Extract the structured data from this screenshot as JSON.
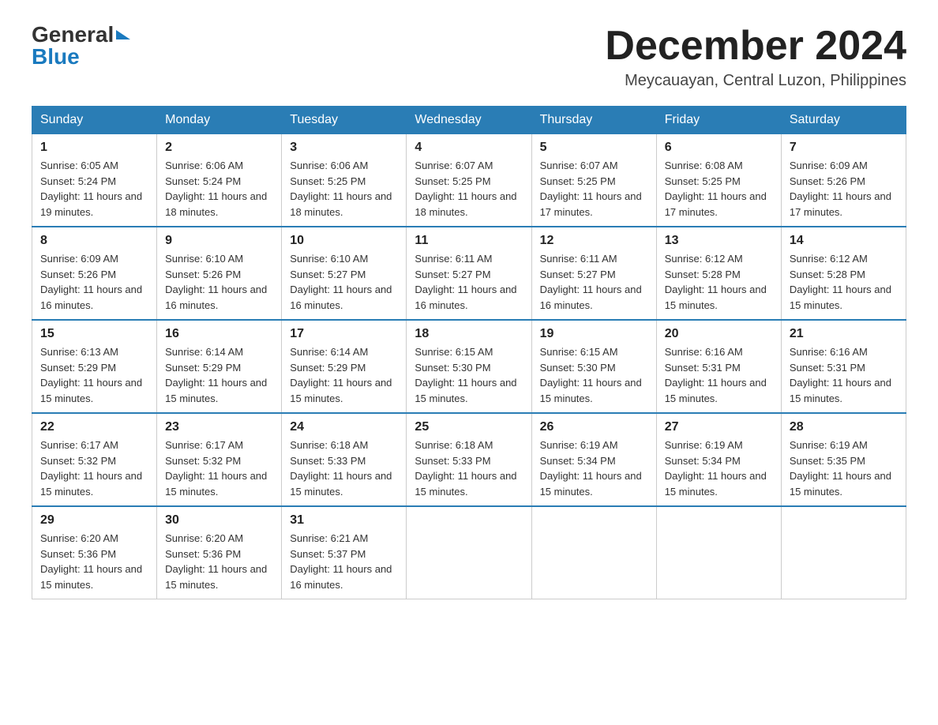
{
  "header": {
    "logo_general": "General",
    "logo_blue": "Blue",
    "month_title": "December 2024",
    "location": "Meycauayan, Central Luzon, Philippines"
  },
  "weekdays": [
    "Sunday",
    "Monday",
    "Tuesday",
    "Wednesday",
    "Thursday",
    "Friday",
    "Saturday"
  ],
  "weeks": [
    [
      {
        "day": "1",
        "sunrise": "6:05 AM",
        "sunset": "5:24 PM",
        "daylight": "11 hours and 19 minutes."
      },
      {
        "day": "2",
        "sunrise": "6:06 AM",
        "sunset": "5:24 PM",
        "daylight": "11 hours and 18 minutes."
      },
      {
        "day": "3",
        "sunrise": "6:06 AM",
        "sunset": "5:25 PM",
        "daylight": "11 hours and 18 minutes."
      },
      {
        "day": "4",
        "sunrise": "6:07 AM",
        "sunset": "5:25 PM",
        "daylight": "11 hours and 18 minutes."
      },
      {
        "day": "5",
        "sunrise": "6:07 AM",
        "sunset": "5:25 PM",
        "daylight": "11 hours and 17 minutes."
      },
      {
        "day": "6",
        "sunrise": "6:08 AM",
        "sunset": "5:25 PM",
        "daylight": "11 hours and 17 minutes."
      },
      {
        "day": "7",
        "sunrise": "6:09 AM",
        "sunset": "5:26 PM",
        "daylight": "11 hours and 17 minutes."
      }
    ],
    [
      {
        "day": "8",
        "sunrise": "6:09 AM",
        "sunset": "5:26 PM",
        "daylight": "11 hours and 16 minutes."
      },
      {
        "day": "9",
        "sunrise": "6:10 AM",
        "sunset": "5:26 PM",
        "daylight": "11 hours and 16 minutes."
      },
      {
        "day": "10",
        "sunrise": "6:10 AM",
        "sunset": "5:27 PM",
        "daylight": "11 hours and 16 minutes."
      },
      {
        "day": "11",
        "sunrise": "6:11 AM",
        "sunset": "5:27 PM",
        "daylight": "11 hours and 16 minutes."
      },
      {
        "day": "12",
        "sunrise": "6:11 AM",
        "sunset": "5:27 PM",
        "daylight": "11 hours and 16 minutes."
      },
      {
        "day": "13",
        "sunrise": "6:12 AM",
        "sunset": "5:28 PM",
        "daylight": "11 hours and 15 minutes."
      },
      {
        "day": "14",
        "sunrise": "6:12 AM",
        "sunset": "5:28 PM",
        "daylight": "11 hours and 15 minutes."
      }
    ],
    [
      {
        "day": "15",
        "sunrise": "6:13 AM",
        "sunset": "5:29 PM",
        "daylight": "11 hours and 15 minutes."
      },
      {
        "day": "16",
        "sunrise": "6:14 AM",
        "sunset": "5:29 PM",
        "daylight": "11 hours and 15 minutes."
      },
      {
        "day": "17",
        "sunrise": "6:14 AM",
        "sunset": "5:29 PM",
        "daylight": "11 hours and 15 minutes."
      },
      {
        "day": "18",
        "sunrise": "6:15 AM",
        "sunset": "5:30 PM",
        "daylight": "11 hours and 15 minutes."
      },
      {
        "day": "19",
        "sunrise": "6:15 AM",
        "sunset": "5:30 PM",
        "daylight": "11 hours and 15 minutes."
      },
      {
        "day": "20",
        "sunrise": "6:16 AM",
        "sunset": "5:31 PM",
        "daylight": "11 hours and 15 minutes."
      },
      {
        "day": "21",
        "sunrise": "6:16 AM",
        "sunset": "5:31 PM",
        "daylight": "11 hours and 15 minutes."
      }
    ],
    [
      {
        "day": "22",
        "sunrise": "6:17 AM",
        "sunset": "5:32 PM",
        "daylight": "11 hours and 15 minutes."
      },
      {
        "day": "23",
        "sunrise": "6:17 AM",
        "sunset": "5:32 PM",
        "daylight": "11 hours and 15 minutes."
      },
      {
        "day": "24",
        "sunrise": "6:18 AM",
        "sunset": "5:33 PM",
        "daylight": "11 hours and 15 minutes."
      },
      {
        "day": "25",
        "sunrise": "6:18 AM",
        "sunset": "5:33 PM",
        "daylight": "11 hours and 15 minutes."
      },
      {
        "day": "26",
        "sunrise": "6:19 AM",
        "sunset": "5:34 PM",
        "daylight": "11 hours and 15 minutes."
      },
      {
        "day": "27",
        "sunrise": "6:19 AM",
        "sunset": "5:34 PM",
        "daylight": "11 hours and 15 minutes."
      },
      {
        "day": "28",
        "sunrise": "6:19 AM",
        "sunset": "5:35 PM",
        "daylight": "11 hours and 15 minutes."
      }
    ],
    [
      {
        "day": "29",
        "sunrise": "6:20 AM",
        "sunset": "5:36 PM",
        "daylight": "11 hours and 15 minutes."
      },
      {
        "day": "30",
        "sunrise": "6:20 AM",
        "sunset": "5:36 PM",
        "daylight": "11 hours and 15 minutes."
      },
      {
        "day": "31",
        "sunrise": "6:21 AM",
        "sunset": "5:37 PM",
        "daylight": "11 hours and 16 minutes."
      },
      null,
      null,
      null,
      null
    ]
  ]
}
